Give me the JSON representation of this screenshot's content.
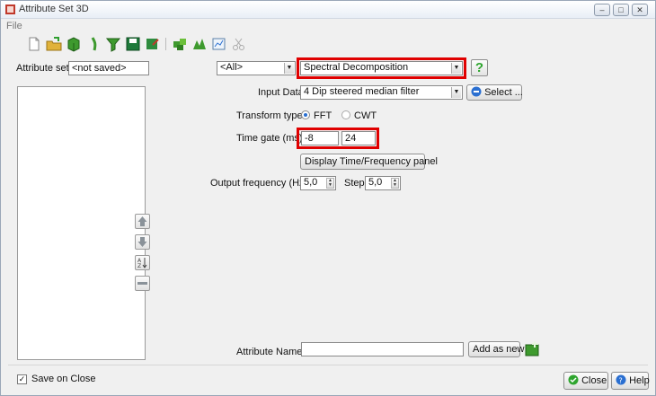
{
  "window": {
    "title": "Attribute Set 3D"
  },
  "menu": {
    "file": "File"
  },
  "toolbar": {
    "icons": [
      "new-document-icon",
      "open-folder-icon",
      "green-cube-icon",
      "wells-icon",
      "filter-icon",
      "save-icon",
      "save-as-icon",
      "cubes-icon",
      "green-cubes-icon",
      "chart-icon",
      "scissors-icon"
    ]
  },
  "attribute_set": {
    "label": "Attribute set",
    "value": "<not saved>"
  },
  "filter_combo": {
    "value": "<All>"
  },
  "method_combo": {
    "value": "Spectral Decomposition"
  },
  "help": {
    "label": "?"
  },
  "input_data": {
    "label": "Input Data",
    "value": "4 Dip steered median filter",
    "select_label": "Select ..."
  },
  "transform_type": {
    "label": "Transform type",
    "options": [
      "FFT",
      "CWT"
    ],
    "selected": "FFT"
  },
  "time_gate": {
    "label": "Time gate (ms)",
    "start": "-8",
    "stop": "24"
  },
  "display_button": {
    "label": "Display Time/Frequency panel"
  },
  "output_frequency": {
    "label": "Output frequency (Hz)",
    "value": "5,0",
    "step_label": "Step",
    "step_value": "5,0"
  },
  "side_buttons": [
    "up-arrow-icon",
    "down-arrow-icon",
    "sort-az-icon",
    "remove-icon"
  ],
  "attribute_name": {
    "label": "Attribute Name",
    "value": "",
    "add_label": "Add as new"
  },
  "footer": {
    "save_on_close": "Save on Close",
    "save_checked": true,
    "close_label": "Close",
    "help_label": "Help"
  },
  "colors": {
    "highlight": "#e00000",
    "accent": "#2a6fd1",
    "help_icon": "#2ea52e"
  }
}
